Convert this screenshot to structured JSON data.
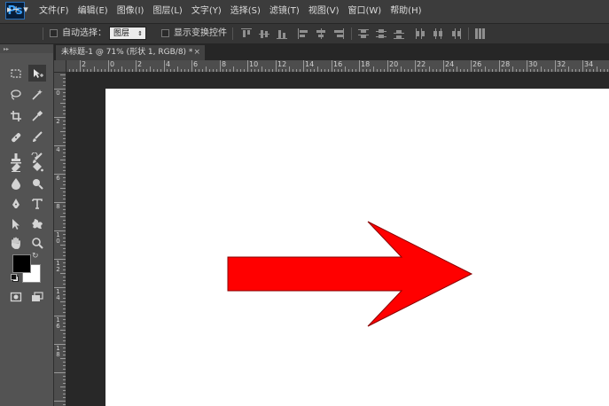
{
  "app": {
    "logo": "Ps"
  },
  "menu": [
    "文件(F)",
    "编辑(E)",
    "图像(I)",
    "图层(L)",
    "文字(Y)",
    "选择(S)",
    "滤镜(T)",
    "视图(V)",
    "窗口(W)",
    "帮助(H)"
  ],
  "options": {
    "move_tool": "▸+ ▾",
    "auto_select_label": "自动选择：",
    "auto_select_target": "图层",
    "show_transform_label": "显示变换控件"
  },
  "document": {
    "tab_title": "未标题-1 @ 71% (形状 1, RGB/8) *",
    "close": "×"
  },
  "ruler": {
    "h_labels": [
      "2",
      "0",
      "2",
      "4",
      "6",
      "8",
      "10",
      "12",
      "14",
      "16",
      "18",
      "20",
      "22",
      "24",
      "26",
      "28",
      "30",
      "32",
      "34"
    ],
    "v_labels": [
      "0",
      "2",
      "4",
      "6",
      "8",
      "10",
      "12",
      "14",
      "16",
      "18"
    ]
  },
  "colors": {
    "foreground": "#000000",
    "background": "#ffffff",
    "shape_fill": "#ff0000",
    "shape_stroke": "#8a0000"
  },
  "tools": [
    "marquee-icon",
    "move-icon",
    "lasso-icon",
    "magic-wand-icon",
    "crop-icon",
    "eyedropper-icon",
    "healing-brush-icon",
    "brush-icon",
    "clone-stamp-icon",
    "history-brush-icon",
    "eraser-icon",
    "paint-bucket-icon",
    "blur-icon",
    "dodge-icon",
    "pen-icon",
    "type-icon",
    "path-selection-icon",
    "custom-shape-icon",
    "hand-icon",
    "zoom-icon"
  ]
}
